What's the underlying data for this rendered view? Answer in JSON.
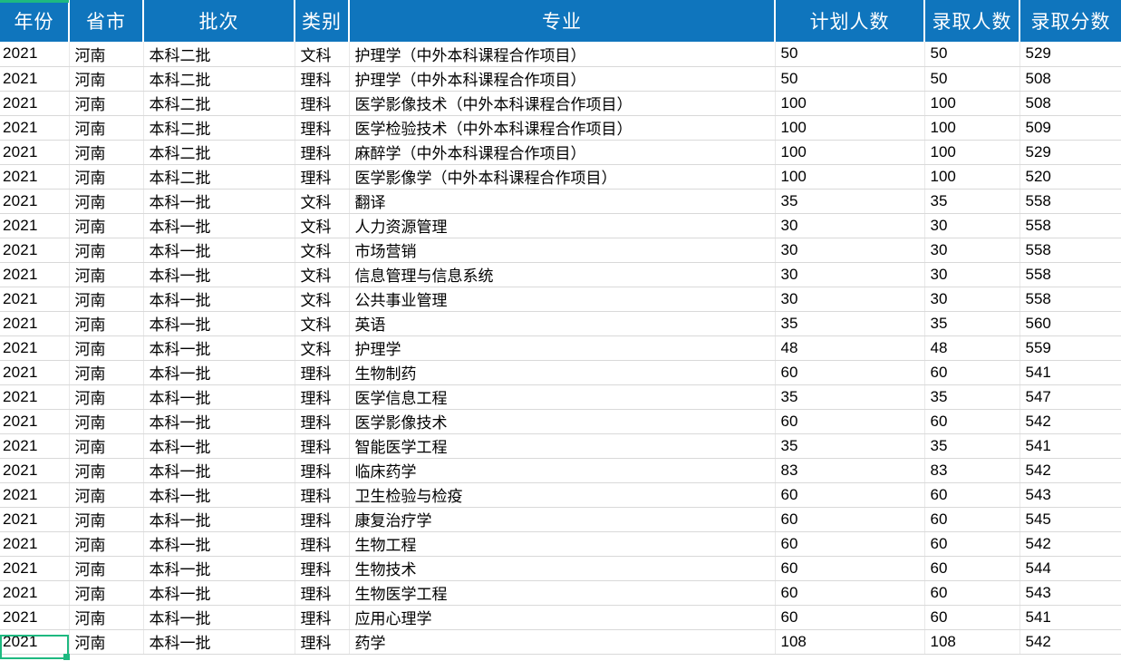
{
  "table": {
    "columns": [
      {
        "key": "year",
        "label": "年份",
        "align": "left"
      },
      {
        "key": "prov",
        "label": "省市",
        "align": "left"
      },
      {
        "key": "batch",
        "label": "批次",
        "align": "left"
      },
      {
        "key": "cat",
        "label": "类别",
        "align": "left"
      },
      {
        "key": "major",
        "label": "专业",
        "align": "left"
      },
      {
        "key": "plan",
        "label": "计划人数",
        "align": "left"
      },
      {
        "key": "adm",
        "label": "录取人数",
        "align": "left"
      },
      {
        "key": "score",
        "label": "录取分数",
        "align": "left"
      }
    ],
    "rows": [
      [
        "2021",
        "河南",
        "本科二批",
        "文科",
        "护理学（中外本科课程合作项目）",
        "50",
        "50",
        "529"
      ],
      [
        "2021",
        "河南",
        "本科二批",
        "理科",
        "护理学（中外本科课程合作项目）",
        "50",
        "50",
        "508"
      ],
      [
        "2021",
        "河南",
        "本科二批",
        "理科",
        "医学影像技术（中外本科课程合作项目）",
        "100",
        "100",
        "508"
      ],
      [
        "2021",
        "河南",
        "本科二批",
        "理科",
        "医学检验技术（中外本科课程合作项目）",
        "100",
        "100",
        "509"
      ],
      [
        "2021",
        "河南",
        "本科二批",
        "理科",
        "麻醉学（中外本科课程合作项目）",
        "100",
        "100",
        "529"
      ],
      [
        "2021",
        "河南",
        "本科二批",
        "理科",
        "医学影像学（中外本科课程合作项目）",
        "100",
        "100",
        "520"
      ],
      [
        "2021",
        "河南",
        "本科一批",
        "文科",
        "翻译",
        "35",
        "35",
        "558"
      ],
      [
        "2021",
        "河南",
        "本科一批",
        "文科",
        "人力资源管理",
        "30",
        "30",
        "558"
      ],
      [
        "2021",
        "河南",
        "本科一批",
        "文科",
        "市场营销",
        "30",
        "30",
        "558"
      ],
      [
        "2021",
        "河南",
        "本科一批",
        "文科",
        "信息管理与信息系统",
        "30",
        "30",
        "558"
      ],
      [
        "2021",
        "河南",
        "本科一批",
        "文科",
        "公共事业管理",
        "30",
        "30",
        "558"
      ],
      [
        "2021",
        "河南",
        "本科一批",
        "文科",
        "英语",
        "35",
        "35",
        "560"
      ],
      [
        "2021",
        "河南",
        "本科一批",
        "文科",
        "护理学",
        "48",
        "48",
        "559"
      ],
      [
        "2021",
        "河南",
        "本科一批",
        "理科",
        "生物制药",
        "60",
        "60",
        "541"
      ],
      [
        "2021",
        "河南",
        "本科一批",
        "理科",
        "医学信息工程",
        "35",
        "35",
        "547"
      ],
      [
        "2021",
        "河南",
        "本科一批",
        "理科",
        "医学影像技术",
        "60",
        "60",
        "542"
      ],
      [
        "2021",
        "河南",
        "本科一批",
        "理科",
        "智能医学工程",
        "35",
        "35",
        "541"
      ],
      [
        "2021",
        "河南",
        "本科一批",
        "理科",
        "临床药学",
        "83",
        "83",
        "542"
      ],
      [
        "2021",
        "河南",
        "本科一批",
        "理科",
        "卫生检验与检疫",
        "60",
        "60",
        "543"
      ],
      [
        "2021",
        "河南",
        "本科一批",
        "理科",
        "康复治疗学",
        "60",
        "60",
        "545"
      ],
      [
        "2021",
        "河南",
        "本科一批",
        "理科",
        "生物工程",
        "60",
        "60",
        "542"
      ],
      [
        "2021",
        "河南",
        "本科一批",
        "理科",
        "生物技术",
        "60",
        "60",
        "544"
      ],
      [
        "2021",
        "河南",
        "本科一批",
        "理科",
        "生物医学工程",
        "60",
        "60",
        "543"
      ],
      [
        "2021",
        "河南",
        "本科一批",
        "理科",
        "应用心理学",
        "60",
        "60",
        "541"
      ],
      [
        "2021",
        "河南",
        "本科一批",
        "理科",
        "药学",
        "108",
        "108",
        "542"
      ]
    ]
  },
  "selection": {
    "cell_value": "2021",
    "row_index": 24,
    "column_key": "year",
    "border_color": "#1eb980"
  },
  "theme": {
    "header_background": "#0f75bd",
    "header_text": "#ffffff",
    "body_text": "#000000",
    "row_border": "#d9d9d9",
    "cell_background": "#ffffff"
  }
}
